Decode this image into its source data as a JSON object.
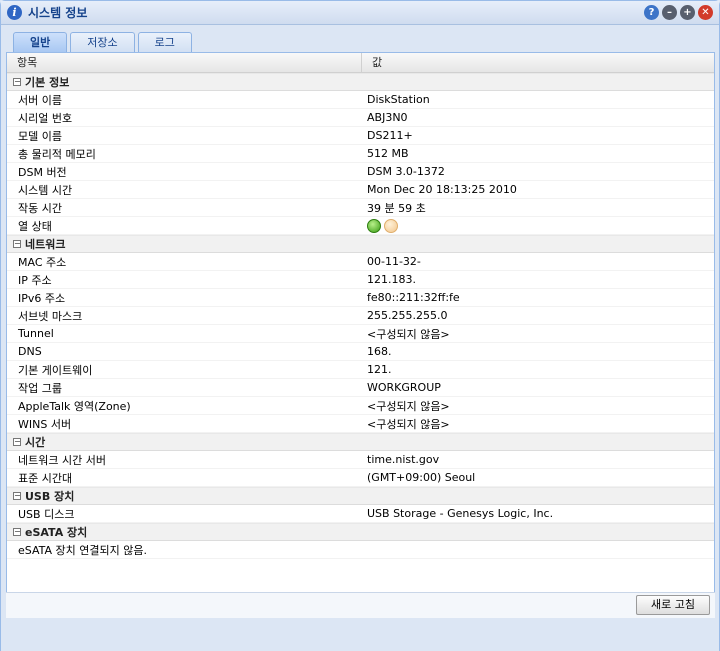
{
  "window": {
    "title": "시스템 정보"
  },
  "tabs": [
    {
      "label": "일반"
    },
    {
      "label": "저장소"
    },
    {
      "label": "로그"
    }
  ],
  "table": {
    "col_item": "항목",
    "col_value": "값",
    "groups": [
      {
        "label": "기본 정보",
        "rows": [
          {
            "k": "서버 이름",
            "v": "DiskStation"
          },
          {
            "k": "시리얼 번호",
            "v": "ABJ3N0"
          },
          {
            "k": "모델 이름",
            "v": "DS211+"
          },
          {
            "k": "총 물리적 메모리",
            "v": "512 MB"
          },
          {
            "k": "DSM 버전",
            "v": "DSM 3.0-1372"
          },
          {
            "k": "시스템 시간",
            "v": "Mon Dec 20 18:13:25 2010"
          },
          {
            "k": "작동 시간",
            "v": "39 분 59 초"
          },
          {
            "k": "열 상태",
            "v": ""
          }
        ]
      },
      {
        "label": "네트워크",
        "rows": [
          {
            "k": "MAC 주소",
            "v": "00-11-32-"
          },
          {
            "k": "IP 주소",
            "v": "121.183."
          },
          {
            "k": "IPv6 주소",
            "v": "fe80::211:32ff:fe"
          },
          {
            "k": "서브넷 마스크",
            "v": "255.255.255.0"
          },
          {
            "k": "Tunnel",
            "v": "<구성되지 않음>"
          },
          {
            "k": "DNS",
            "v": "168."
          },
          {
            "k": "기본 게이트웨이",
            "v": "121."
          },
          {
            "k": "작업 그룹",
            "v": "WORKGROUP"
          },
          {
            "k": "AppleTalk 영역(Zone)",
            "v": "<구성되지 않음>"
          },
          {
            "k": "WINS 서버",
            "v": "<구성되지 않음>"
          }
        ]
      },
      {
        "label": "시간",
        "rows": [
          {
            "k": "네트워크 시간 서버",
            "v": "time.nist.gov"
          },
          {
            "k": "표준 시간대",
            "v": "(GMT+09:00) Seoul"
          }
        ]
      },
      {
        "label": "USB 장치",
        "rows": [
          {
            "k": "USB 디스크",
            "v": "USB Storage - Genesys Logic, Inc."
          }
        ]
      },
      {
        "label": "eSATA 장치",
        "rows": [
          {
            "k": "eSATA 장치 연결되지 않음.",
            "v": ""
          }
        ]
      }
    ]
  },
  "footer": {
    "refresh_label": "새로 고침"
  },
  "colors": {
    "title": "#15428b",
    "accent": "#99bbe8",
    "status_ok": "#3a9c14",
    "status_warm": "#f2c68c"
  }
}
